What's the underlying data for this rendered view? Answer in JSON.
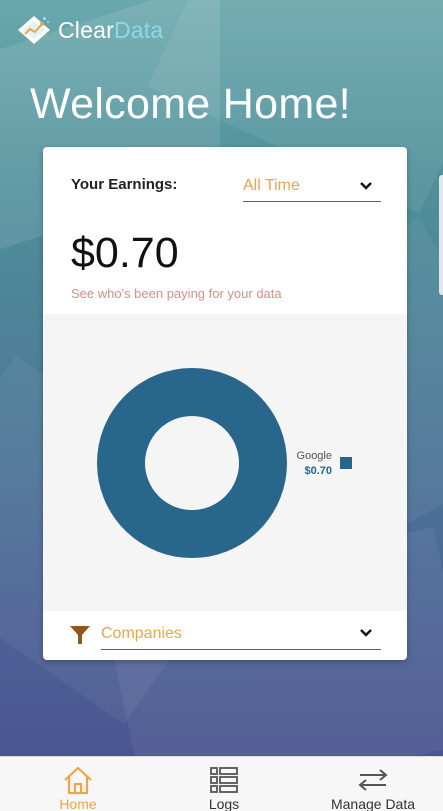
{
  "app": {
    "brand_part1": "Clear",
    "brand_part2": "Data",
    "title": "Welcome Home!"
  },
  "earnings": {
    "label": "Your Earnings:",
    "period_selected": "All Time",
    "amount": "$0.70",
    "link": "See who's been paying for your data"
  },
  "chart_data": {
    "type": "pie",
    "donut": true,
    "categories": [
      "Google"
    ],
    "values": [
      0.7
    ],
    "value_labels": [
      "$0.70"
    ],
    "legend_position": "right",
    "colors": [
      "#28668c"
    ]
  },
  "filter": {
    "selected": "Companies"
  },
  "bottom_nav": {
    "items": [
      {
        "label": "Home",
        "icon": "home-icon",
        "active": true
      },
      {
        "label": "Logs",
        "icon": "list-icon",
        "active": false
      },
      {
        "label": "Manage Data",
        "icon": "swap-arrows-icon",
        "active": false
      }
    ]
  },
  "colors": {
    "accent": "#f0a446",
    "chart": "#28668c",
    "link": "#d68f84"
  }
}
